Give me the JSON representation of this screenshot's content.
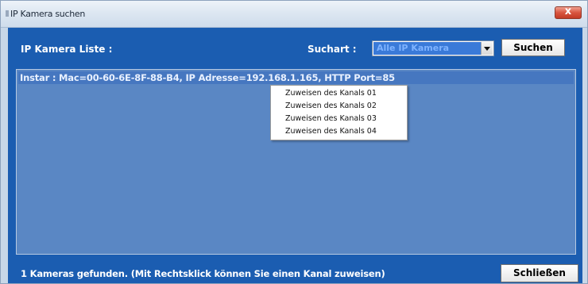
{
  "window": {
    "title": "IP Kamera suchen",
    "close_label": "x"
  },
  "header": {
    "list_label": "IP Kamera Liste :",
    "search_type_label": "Suchart :",
    "search_type_value": "Alle IP Kamera",
    "search_button": "Suchen"
  },
  "list": {
    "rows": [
      "Instar : Mac=00-60-6E-8F-88-B4,  IP Adresse=192.168.1.165,  HTTP Port=85"
    ]
  },
  "context_menu": {
    "items": [
      "Zuweisen des Kanals 01",
      "Zuweisen des Kanals 02",
      "Zuweisen des Kanals 03",
      "Zuweisen des Kanals 04"
    ]
  },
  "footer": {
    "status": "1 Kameras gefunden. (Mit Rechtsklick können Sie einen Kanal zuweisen)",
    "close_button": "Schließen"
  },
  "colors": {
    "panel": "#1b5db1",
    "list_bg": "#5a87c4",
    "selection": "#3a7ad8"
  },
  "icons": [
    "window-icon",
    "close-icon",
    "dropdown-arrow-icon"
  ]
}
